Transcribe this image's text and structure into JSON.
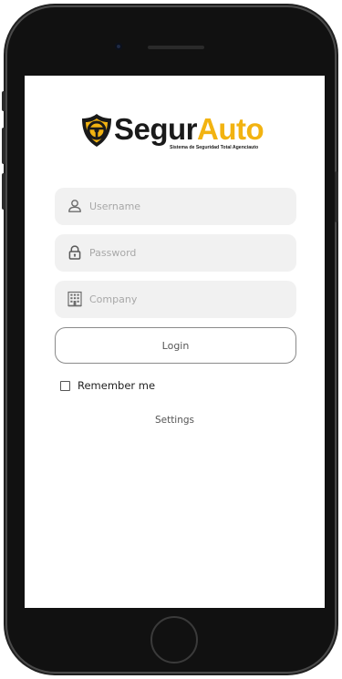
{
  "brand": {
    "name_part1": "Segur",
    "name_part2": "Auto",
    "tagline": "Sistema de Seguridad Total Agenciauto",
    "colors": {
      "accent": "#f2b311",
      "dark": "#1a1a1a"
    }
  },
  "form": {
    "username": {
      "placeholder": "Username",
      "value": "",
      "icon": "user-icon"
    },
    "password": {
      "placeholder": "Password",
      "value": "",
      "icon": "lock-icon"
    },
    "company": {
      "placeholder": "Company",
      "value": "",
      "icon": "building-icon"
    },
    "login_label": "Login",
    "remember_label": "Remember me",
    "remember_checked": false,
    "settings_label": "Settings"
  }
}
